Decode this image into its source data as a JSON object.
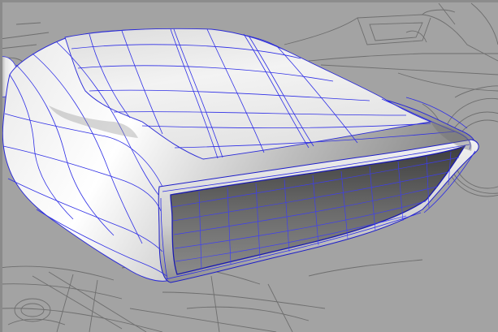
{
  "viewport": {
    "background_color": "#a3a3a3",
    "wire_color": "#2e2ee6",
    "blueprint_line_color": "#6b6b6b",
    "body_light_color": "#f4f4f4",
    "body_shade_color": "#7f7f7f",
    "grille_color": "#5c5c5c"
  }
}
